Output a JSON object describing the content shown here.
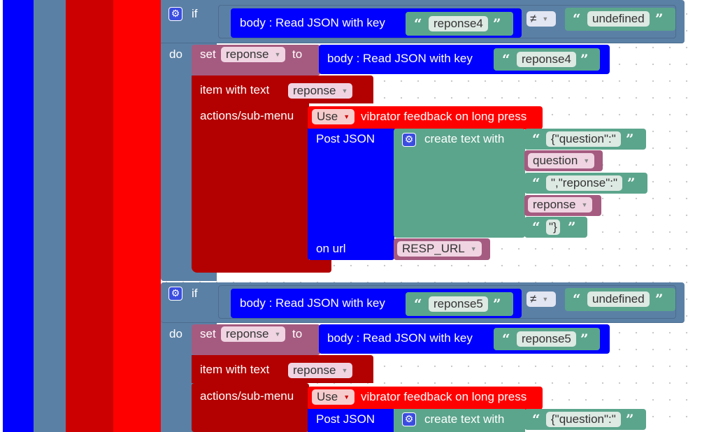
{
  "colors": {
    "blue": "#0000ff",
    "slate": "#5b80a5",
    "red": "#ff0000",
    "darkred": "#b30000",
    "var": "#a55b80",
    "text": "#5ba58c",
    "bg": "#ffffff"
  },
  "block1": {
    "if_label": "if",
    "do_label": "do",
    "cond_read_label": "body : Read JSON with key",
    "cond_key": "reponse4",
    "op": "≠",
    "undefined": "undefined",
    "set_label": "set",
    "set_var": "reponse",
    "to_label": "to",
    "set_read_label": "body : Read JSON with key",
    "set_key": "reponse4",
    "item_label": "item with text",
    "item_var": "reponse",
    "actions_label": "actions/sub-menu",
    "use_label": "Use",
    "vibrator_label": "vibrator feedback on long press",
    "post_label": "Post JSON",
    "create_label": "create text with",
    "str_question": "{\"question\":\"",
    "var_question": "question",
    "str_reponse": "\",\"reponse\":\"",
    "var_reponse": "reponse",
    "str_close": "\"}",
    "on_url_label": "on url",
    "url_var": "RESP_URL"
  },
  "block2": {
    "if_label": "if",
    "do_label": "do",
    "cond_read_label": "body : Read JSON with key",
    "cond_key": "reponse5",
    "op": "≠",
    "undefined": "undefined",
    "set_label": "set",
    "set_var": "reponse",
    "to_label": "to",
    "set_read_label": "body : Read JSON with key",
    "set_key": "reponse5",
    "item_label": "item with text",
    "item_var": "reponse",
    "actions_label": "actions/sub-menu",
    "use_label": "Use",
    "vibrator_label": "vibrator feedback on long press",
    "post_label": "Post JSON",
    "create_label": "create text with",
    "str_question": "{\"question\":\""
  }
}
